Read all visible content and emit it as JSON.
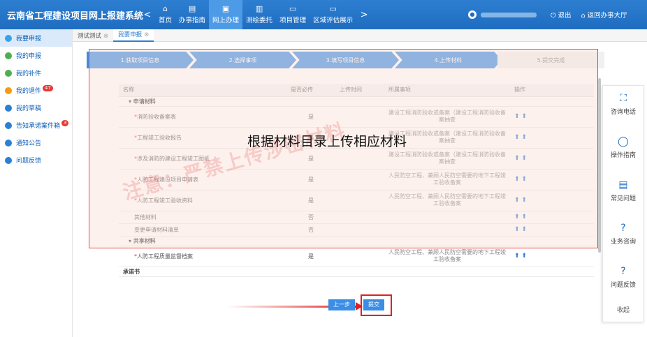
{
  "app": {
    "title": "云南省工程建设项目网上报建系统"
  },
  "nav": {
    "left_arrow": "<",
    "right_arrow": ">",
    "items": [
      {
        "label": "首页",
        "icon": "home-icon"
      },
      {
        "label": "办事指南",
        "icon": "guide-icon"
      },
      {
        "label": "网上办理",
        "icon": "monitor-icon",
        "active": true
      },
      {
        "label": "测绘委托",
        "icon": "survey-icon"
      },
      {
        "label": "项目管理",
        "icon": "folder-icon"
      },
      {
        "label": "区域评估展示",
        "icon": "folder-icon"
      }
    ]
  },
  "user": {
    "logout": "退出",
    "back": "返回办事大厅"
  },
  "sidebar": {
    "items": [
      {
        "label": "我要申报",
        "color": "#3aa0e8"
      },
      {
        "label": "我的申报",
        "color": "#4caf50"
      },
      {
        "label": "我的补件",
        "color": "#4caf50"
      },
      {
        "label": "我的退件",
        "color": "#f39c12",
        "badge": "47"
      },
      {
        "label": "我的草稿",
        "color": "#2d7fd1"
      },
      {
        "label": "告知承诺案件箱",
        "color": "#2d7fd1",
        "badge": "3"
      },
      {
        "label": "通知公告",
        "color": "#2d7fd1"
      },
      {
        "label": "问题反馈",
        "color": "#2d7fd1"
      }
    ]
  },
  "tabs": [
    {
      "label": "测试测试"
    },
    {
      "label": "我要申报"
    }
  ],
  "steps": [
    "1.获取项目信息",
    "2.选择事项",
    "3.填写项目信息",
    "4.上传材料",
    "5.提交完成"
  ],
  "table": {
    "headers": [
      "名称",
      "是否必传",
      "上传时间",
      "所属事项",
      "操作"
    ],
    "group1": "▾ 申请材料",
    "rows": [
      {
        "name": "消防验收备案表",
        "required": "是",
        "item": "建设工程消防验收或备案（建设工程消防验收备案抽查",
        "star": true
      },
      {
        "name": "工程竣工验收报告",
        "required": "是",
        "item": "建设工程消防验收或备案（建设工程消防验收备案抽查",
        "star": true
      },
      {
        "name": "涉及消防的建设工程竣工图纸",
        "required": "是",
        "item": "建设工程消防验收或备案（建设工程消防验收备案抽查",
        "star": true
      },
      {
        "name": "人防工程建设项目申请表",
        "required": "是",
        "item": "人民防空工程、兼顾人民防空需要的地下工程竣工验收备案",
        "star": true
      },
      {
        "name": "人防工程竣工验收资料",
        "required": "是",
        "item": "人民防空工程、兼顾人民防空需要的地下工程竣工验收备案",
        "star": true
      },
      {
        "name": "其他材料",
        "required": "否",
        "item": "",
        "star": false
      },
      {
        "name": "变更申请材料清单",
        "required": "否",
        "item": "",
        "star": false
      }
    ],
    "group2": "▾ 共享材料",
    "shared_rows": [
      {
        "name": "人防工程质量监督档案",
        "required": "是",
        "item": "人民防空工程、兼顾人民防空需要的地下工程竣工验收备案",
        "star": true
      }
    ],
    "commitment": "承诺书",
    "ops": "⬆ ⬆"
  },
  "buttons": {
    "prev": "上一步",
    "submit": "提交"
  },
  "overlay": {
    "caption": "根据材料目录上传相应材料",
    "watermark": "注意：严禁上传涉密材料"
  },
  "float_panel": {
    "items": [
      {
        "label": "咨询电话",
        "icon": "phone-frame-icon"
      },
      {
        "label": "操作指南",
        "icon": "ring-icon"
      },
      {
        "label": "常见问题",
        "icon": "document-icon"
      },
      {
        "label": "业务咨询",
        "icon": "question-icon"
      },
      {
        "label": "问题反馈",
        "icon": "question-icon"
      }
    ],
    "collapse": "收起"
  }
}
